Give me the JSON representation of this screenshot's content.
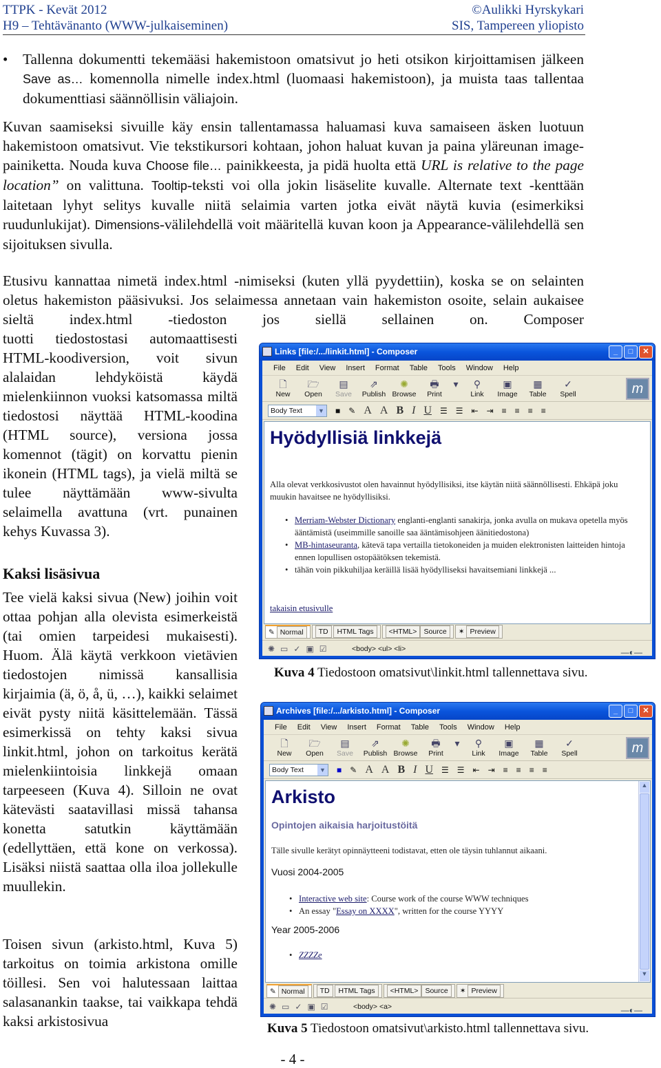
{
  "header": {
    "left1": "TTPK - Kevät 2012",
    "left2": "H9 – Tehtävänanto (WWW-julkaiseminen)",
    "right1": "©Aulikki Hyrskykari",
    "right2": "SIS, Tampereen yliopisto"
  },
  "bullet": {
    "a": "Tallenna dokumentti tekemääsi hakemistoon omatsivut jo heti otsikon kirjoittamisen jälkeen ",
    "save_as": "Save as…",
    "b": " komennolla nimelle index.html (luomaasi hakemistoon), ja muista taas tallentaa dokumenttiasi säännöllisin väliajoin."
  },
  "p2": {
    "a": "Kuvan saamiseksi sivuille käy ensin tallentamassa haluamasi kuva samaiseen äsken luotuun hakemistoon omatsivut. Vie tekstikursori kohtaan, johon haluat kuvan ja paina yläreunan image-painiketta. Nouda kuva ",
    "choose": "Choose file…",
    "b": " painikkeesta, ja pidä huolta että ",
    "url": "URL is relative to the page location”",
    "c": " on valittuna. ",
    "tooltip": "Tooltip",
    "d": "-teksti voi olla jokin lisäselite kuvalle. Alternate text -kenttään laitetaan lyhyt selitys kuvalle niitä selaimia varten jotka eivät näytä kuvia (esimerkiksi ruudunlukijat). ",
    "dims": "Dimensions",
    "e": "-välilehdellä voit määritellä kuvan koon ja Appearance-välilehdellä sen sijoituksen sivulla."
  },
  "p3": {
    "full": "Etusivu kannattaa nimetä index.html -nimiseksi (kuten yllä pyydettiin), koska se on selainten oletus hakemiston pääsivuksi. Jos selaimessa annetaan vain hakemiston osoite, selain aukaisee sieltä index.html -tiedoston jos siellä sellainen on. Composer",
    "col": "tuotti tiedostostasi automaattisesti HTML-koodiversion, voit sivun alalaidan lehdyköistä käydä mielenkiinnon vuoksi katsomassa miltä tiedostosi näyttää HTML-koodina (HTML source), versiona jossa komennot (tägit) on korvattu pienin ikonein (HTML tags), ja vielä miltä se tulee näyttämään www-sivulta selaimella avattuna (vrt. punainen kehys Kuvassa 3)."
  },
  "section": {
    "title": "Kaksi lisäsivua",
    "p1": "Tee vielä kaksi sivua (New) joihin voit ottaa pohjan alla olevista esimerkeistä (tai omien tarpeidesi mukaisesti). Huom. Älä käytä verkkoon vietävien tiedostojen nimissä kansallisia kirjaimia (ä, ö, å, ü, …), kaikki selaimet eivät pysty niitä käsittelemään. Tässä esimerkissä on tehty kaksi sivua linkit.html, johon on tarkoitus kerätä mielenkiintoisia linkkejä omaan tarpeeseen (Kuva 4). Silloin ne ovat kätevästi saatavillasi missä tahansa konetta satutkin käyttämään (edellyttäen, että kone on verkossa). Lisäksi niistä saattaa olla iloa jollekulle muullekin.",
    "p2": "Toisen sivun (arkisto.html, Kuva 5) tarkoitus on toimia arkistona omille töillesi. Sen voi halutessaan laittaa salasanankin taakse, tai vaikkapa tehdä kaksi arkistosivua"
  },
  "composer": {
    "menu": [
      "File",
      "Edit",
      "View",
      "Insert",
      "Format",
      "Table",
      "Tools",
      "Window",
      "Help"
    ],
    "toolbar": [
      "New",
      "Open",
      "Save",
      "Publish",
      "Browse",
      "Print",
      "Link",
      "Image",
      "Table",
      "Spell"
    ],
    "style_select": "Body Text",
    "tabs": [
      "Normal",
      "HTML Tags",
      "Source",
      "Preview"
    ],
    "tab_prefix": [
      "",
      "TD",
      "<HTML>",
      ""
    ],
    "accent": "#0a4fd6"
  },
  "fig4": {
    "window_title": "Links [file:/.../linkit.html] - Composer",
    "heading": "Hyödyllisiä linkkejä",
    "intro": "Alla olevat verkkosivustot olen havainnut hyödyllisiksi, itse käytän niitä säännöllisesti. Ehkäpä joku muukin havaitsee ne hyödyllisiksi.",
    "items": [
      {
        "link": "Merriam-Webster Dictionary",
        "text": " englanti-englanti sanakirja, jonka avulla on mukava opetella myös ääntämistä (useimmille sanoille saa ääntämisohjeen äänitiedostona)"
      },
      {
        "link": "MB-hintaseuranta",
        "text": ", kätevä tapa vertailla tietokoneiden ja muiden elektronisten laitteiden hintoja ennen lopullisen ostopäätöksen tekemistä."
      },
      {
        "link": "",
        "text": "tähän voin pikkuhiljaa keräillä lisää hyödylliseksi havaitsemiani linkkejä  ..."
      }
    ],
    "back_link": "takaisin etusivulle",
    "status_path": "<body> <ul> <li>",
    "caption_num": "Kuva 4",
    "caption": " Tiedostoon omatsivut\\linkit.html tallennettava sivu."
  },
  "fig5": {
    "window_title": "Archives [file:/.../arkisto.html] - Composer",
    "heading": "Arkisto",
    "subheading": "Opintojen aikaisia harjoitustöitä",
    "intro": "Tälle sivulle kerätyt opinnäytteeni todistavat, etten ole täysin tuhlannut aikaani.",
    "year1": "Vuosi 2004-2005",
    "items1": [
      {
        "pre": "",
        "link": "Interactive web site",
        "post": ": Course work of the course WWW techniques"
      },
      {
        "pre": "An essay \"",
        "link": "Essay on XXXX",
        "post": "\", written for the course YYYY"
      }
    ],
    "year2": "Year 2005-2006",
    "items2": [
      {
        "link": "ZZZZe"
      }
    ],
    "status_path": "<body> <a>",
    "caption_num": "Kuva 5",
    "caption": " Tiedostoon omatsivut\\arkisto.html tallennettava sivu."
  },
  "page_number": "- 4 -"
}
